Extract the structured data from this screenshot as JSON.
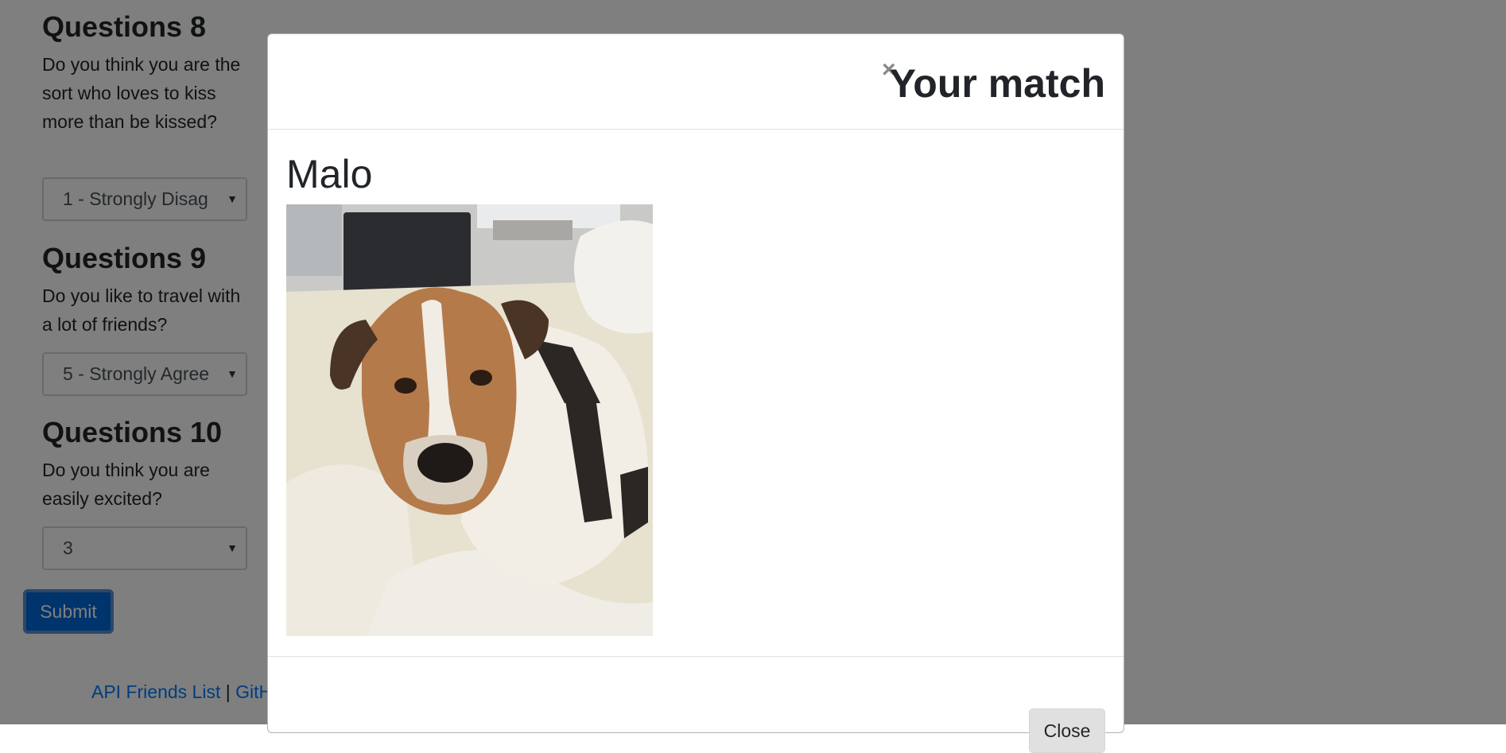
{
  "questions": [
    {
      "title": "Questions 8",
      "text": "Do you think you are the sort who loves to kiss more than be kissed?",
      "selected": "1 - Strongly Disag"
    },
    {
      "title": "Questions 9",
      "text": "Do you like to travel with a lot of friends?",
      "selected": "5 - Strongly Agree"
    },
    {
      "title": "Questions 10",
      "text": "Do you think you are easily excited?",
      "selected": "3"
    }
  ],
  "submit_label": "Submit",
  "footer": {
    "link1": "API Friends List",
    "separator": "|",
    "link2": "GitH"
  },
  "modal": {
    "close_symbol": "×",
    "title": "Your match",
    "match_name": "Malo",
    "close_label": "Close"
  },
  "icons": {
    "close": "close-icon",
    "dropdown": "chevron-down-icon"
  },
  "colors": {
    "primary": "#007bff",
    "overlay": "rgba(0,0,0,0.5)"
  }
}
